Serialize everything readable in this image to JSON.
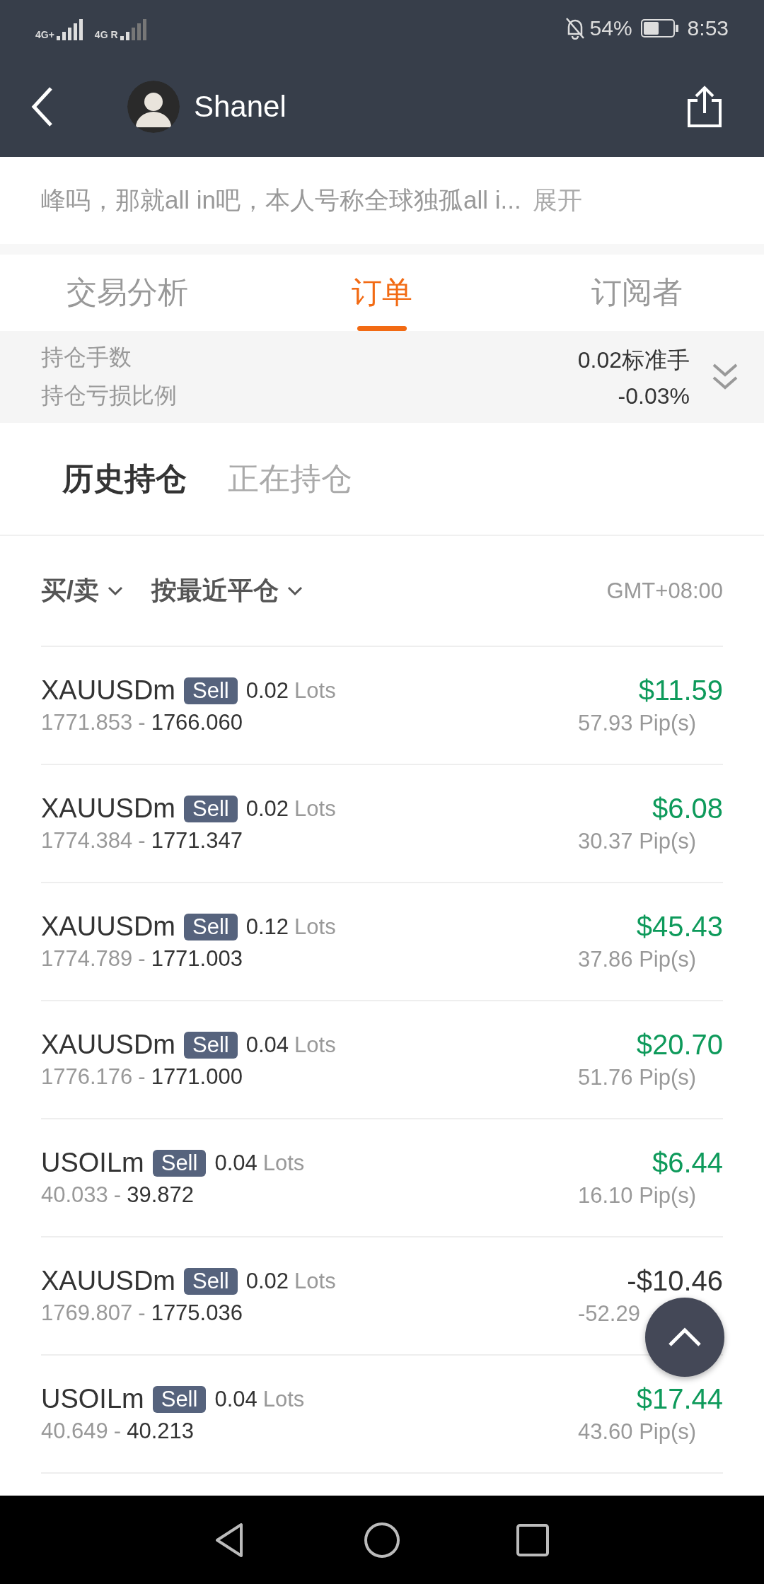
{
  "status_bar": {
    "network_labels": [
      "4G+",
      "4G R"
    ],
    "battery": "54%",
    "time": "8:53"
  },
  "header": {
    "title": "Shanel"
  },
  "bio": {
    "text": "峰吗，那就all in吧，本人号称全球独孤all i...",
    "expand": "展开"
  },
  "tabs": [
    {
      "label": "交易分析",
      "selected": false
    },
    {
      "label": "订单",
      "selected": true
    },
    {
      "label": "订阅者",
      "selected": false
    }
  ],
  "summary": [
    {
      "label": "持仓手数",
      "value": "0.02标准手"
    },
    {
      "label": "持仓亏损比例",
      "value": "-0.03%"
    }
  ],
  "position_tabs": [
    {
      "label": "历史持仓",
      "selected": true
    },
    {
      "label": "正在持仓",
      "selected": false
    }
  ],
  "filters": [
    {
      "label": "买/卖"
    },
    {
      "label": "按最近平仓"
    }
  ],
  "timezone": "GMT+08:00",
  "orders": [
    {
      "symbol": "XAUUSDm",
      "side": "Sell",
      "lots": "0.02",
      "unit": "Lots",
      "open": "1771.853",
      "separator": "-",
      "close": "1766.060",
      "profit": "$11.59",
      "pips": "57.93 Pip(s)",
      "gain": true
    },
    {
      "symbol": "XAUUSDm",
      "side": "Sell",
      "lots": "0.02",
      "unit": "Lots",
      "open": "1774.384",
      "separator": "-",
      "close": "1771.347",
      "profit": "$6.08",
      "pips": "30.37 Pip(s)",
      "gain": true
    },
    {
      "symbol": "XAUUSDm",
      "side": "Sell",
      "lots": "0.12",
      "unit": "Lots",
      "open": "1774.789",
      "separator": "-",
      "close": "1771.003",
      "profit": "$45.43",
      "pips": "37.86 Pip(s)",
      "gain": true
    },
    {
      "symbol": "XAUUSDm",
      "side": "Sell",
      "lots": "0.04",
      "unit": "Lots",
      "open": "1776.176",
      "separator": "-",
      "close": "1771.000",
      "profit": "$20.70",
      "pips": "51.76 Pip(s)",
      "gain": true
    },
    {
      "symbol": "USOILm",
      "side": "Sell",
      "lots": "0.04",
      "unit": "Lots",
      "open": "40.033",
      "separator": "-",
      "close": "39.872",
      "profit": "$6.44",
      "pips": "16.10 Pip(s)",
      "gain": true
    },
    {
      "symbol": "XAUUSDm",
      "side": "Sell",
      "lots": "0.02",
      "unit": "Lots",
      "open": "1769.807",
      "separator": "-",
      "close": "1775.036",
      "profit": "-$10.46",
      "pips": "-52.29",
      "gain": false
    },
    {
      "symbol": "USOILm",
      "side": "Sell",
      "lots": "0.04",
      "unit": "Lots",
      "open": "40.649",
      "separator": "-",
      "close": "40.213",
      "profit": "$17.44",
      "pips": "43.60 Pip(s)",
      "gain": true
    }
  ]
}
